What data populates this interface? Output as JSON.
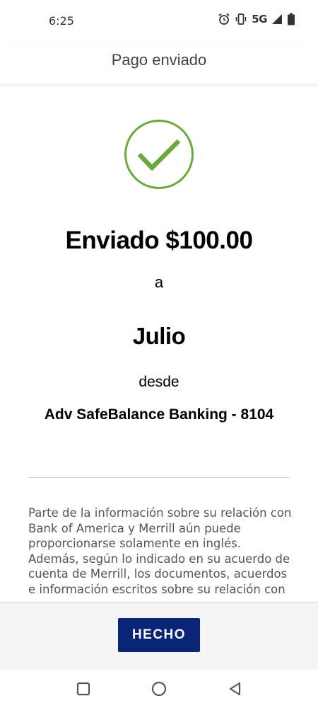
{
  "status_bar": {
    "time": "6:25",
    "network": "5G",
    "icons": [
      "alarm-icon",
      "vibrate-icon",
      "signal-icon",
      "battery-icon"
    ]
  },
  "header": {
    "title": "Pago enviado"
  },
  "confirmation": {
    "icon": "checkmark-circle-icon",
    "amount_text": "Enviado $100.00",
    "to_prep": "a",
    "recipient": "Julio",
    "from_prep": "desde",
    "account": "Adv SafeBalance Banking - 8104"
  },
  "disclaimer": {
    "text": "Parte de la información sobre su relación con Bank of America y Merrill aún puede proporcionarse solamente en inglés. Además, según lo indicado en su acuerdo de cuenta de Merrill, los documentos, acuerdos e información escritos sobre su relación con"
  },
  "footer": {
    "done_label": "HECHO"
  },
  "nav": {
    "icons": [
      "recents-square-icon",
      "home-circle-icon",
      "back-triangle-icon"
    ]
  },
  "colors": {
    "check_green": "#6aaa3a",
    "button_navy": "#0a2478"
  }
}
